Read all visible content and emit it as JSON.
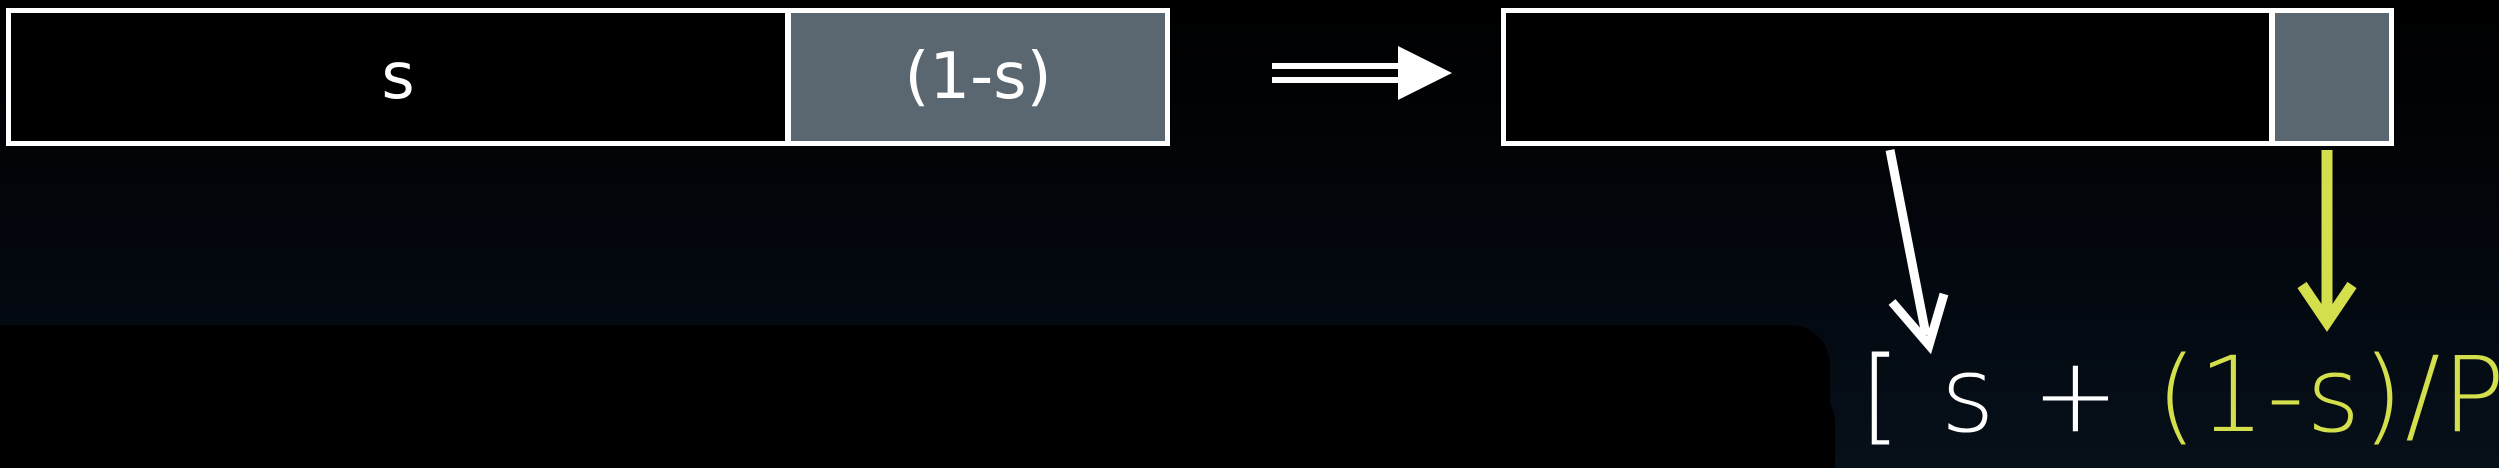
{
  "left_bar": {
    "serial_label": "s",
    "parallel_label": "(1-s)"
  },
  "right_bar": {},
  "formula": {
    "open_bracket": "[",
    "serial_term": "s",
    "plus": " + ",
    "parallel_term": "(1-s)",
    "divisor": "/P",
    "close_bracket": " ]"
  },
  "colors": {
    "background": "#000000",
    "serial_fill": "#000000",
    "parallel_fill": "#5b6770",
    "outline": "#ffffff",
    "highlight": "#d4df4c"
  }
}
